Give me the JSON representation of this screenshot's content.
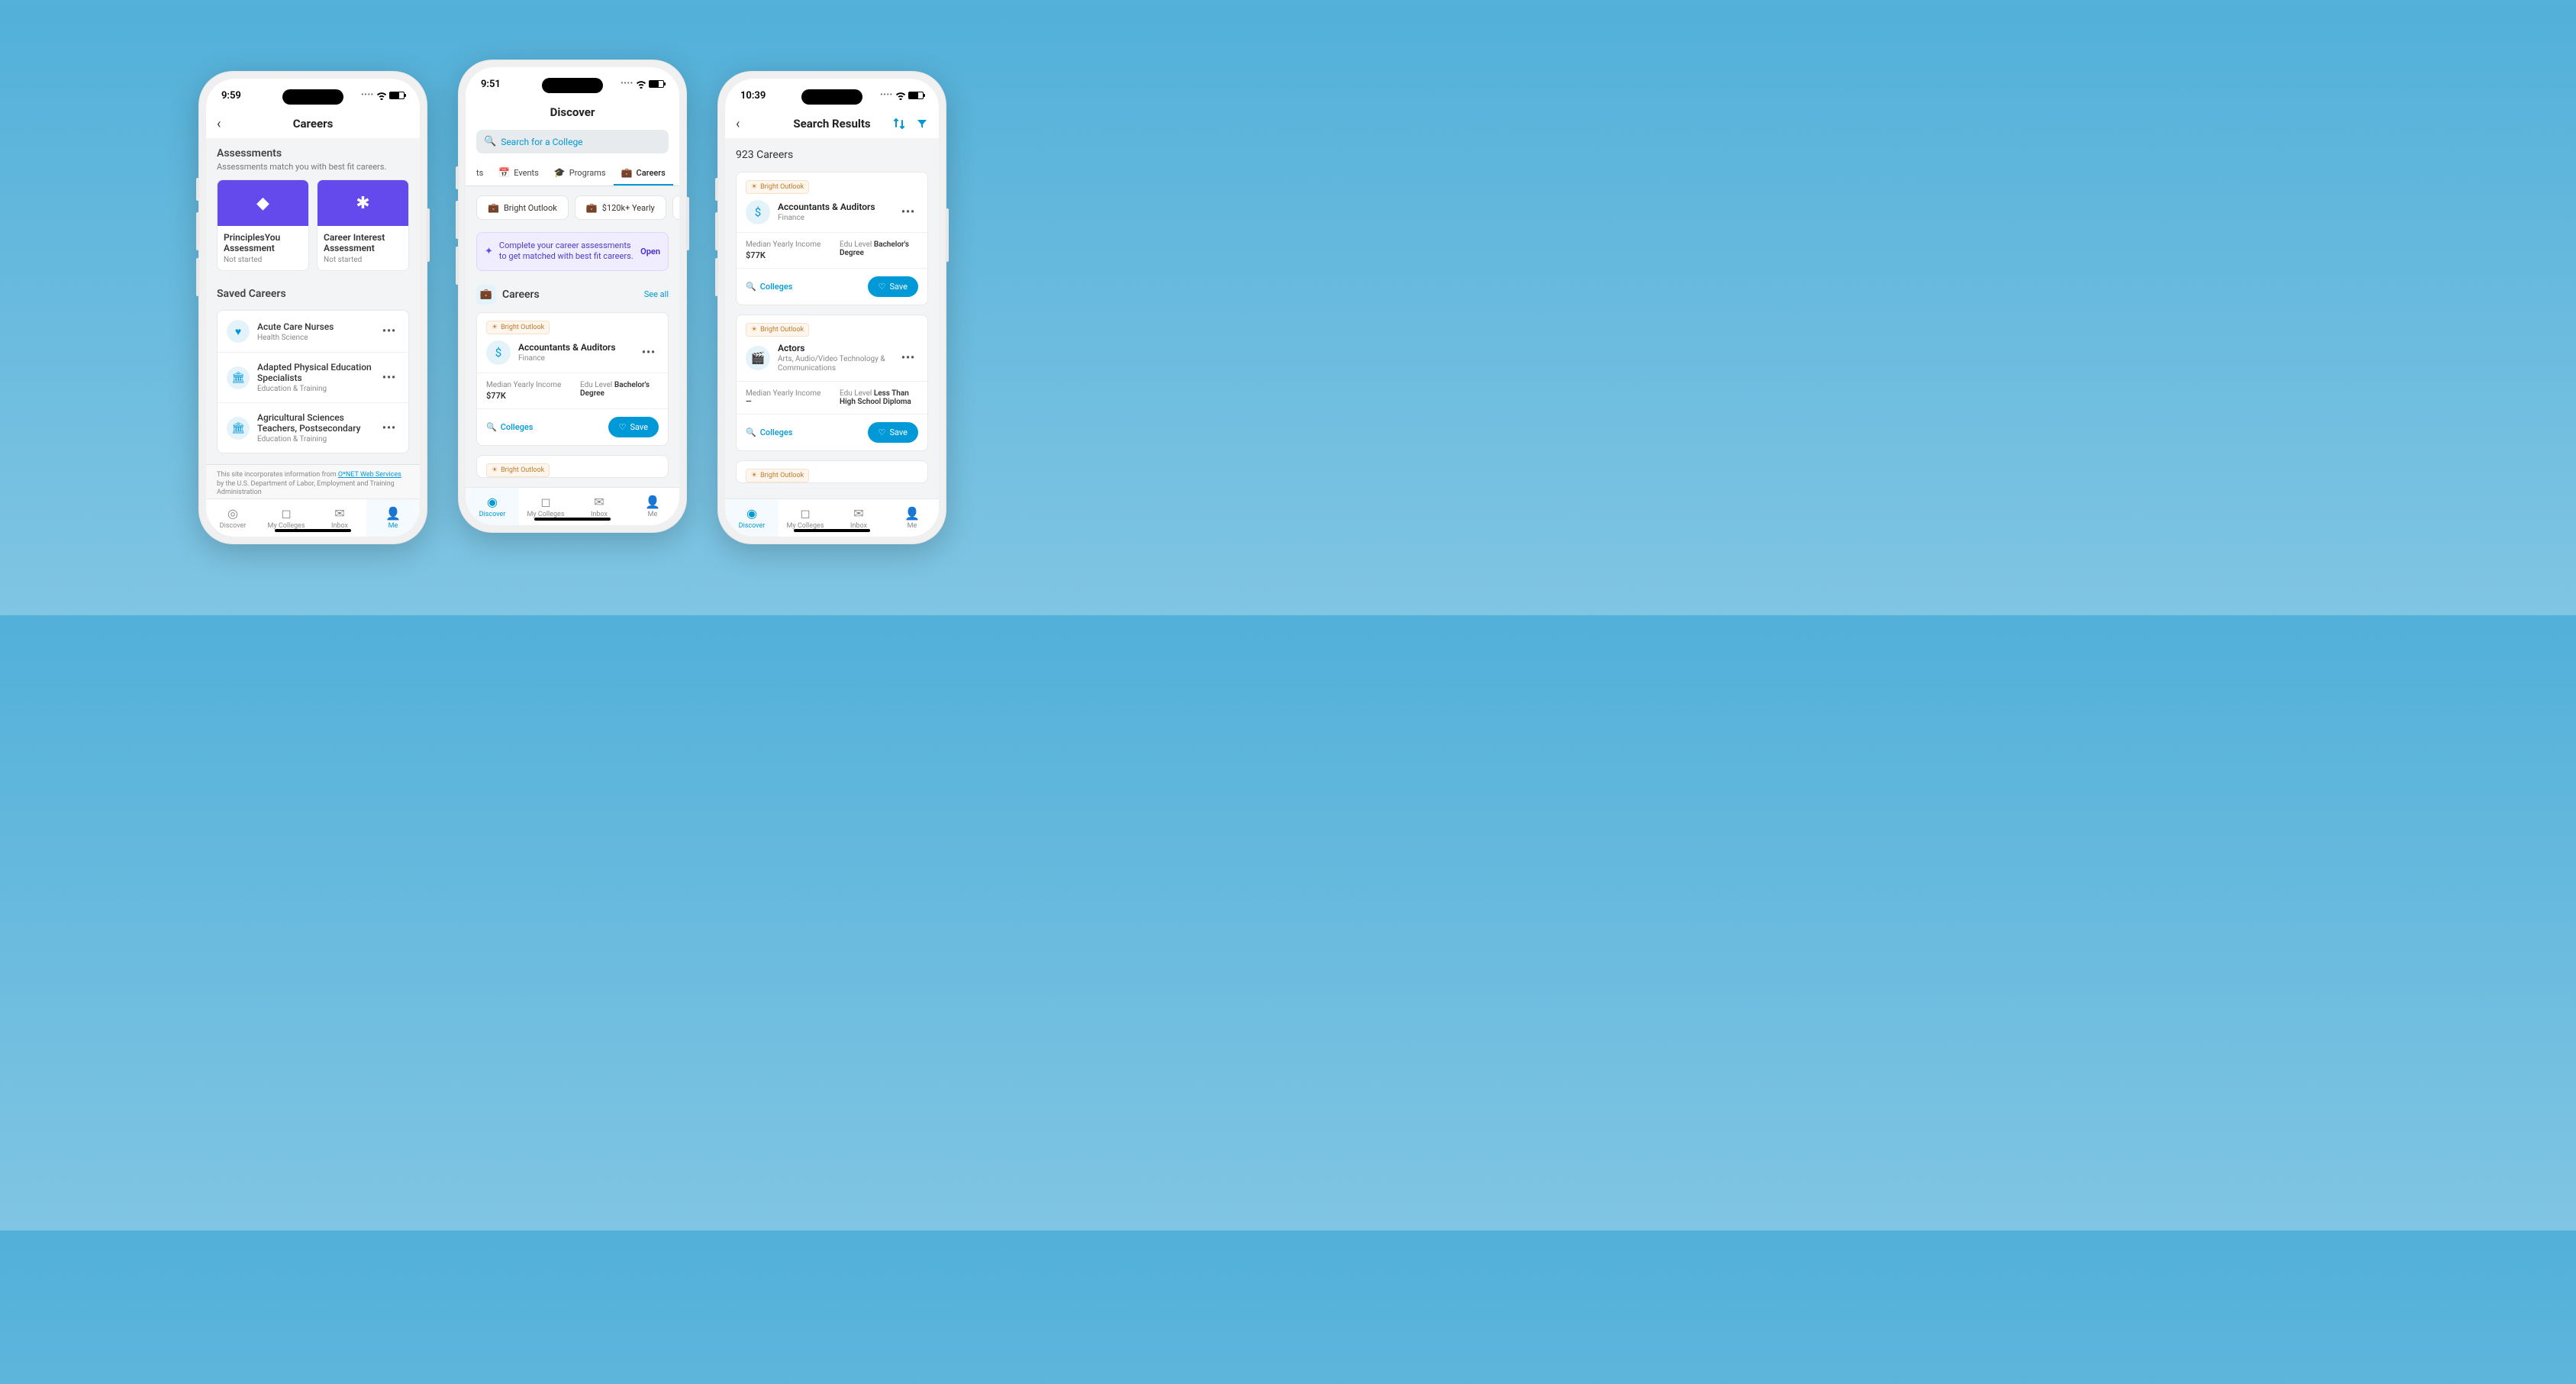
{
  "colors": {
    "accent": "#0099d8",
    "purple": "#6449ed"
  },
  "phone1": {
    "time": "9:59",
    "title": "Careers",
    "assessments": {
      "heading": "Assessments",
      "sub": "Assessments match you with best fit careers.",
      "cards": [
        {
          "title": "PrinciplesYou Assessment",
          "status": "Not started",
          "icon": "◆"
        },
        {
          "title": "Career Interest Assessment",
          "status": "Not started",
          "icon": "✱"
        }
      ]
    },
    "saved": {
      "heading": "Saved Careers",
      "items": [
        {
          "title": "Acute Care Nurses",
          "sub": "Health Science",
          "icon": "heart"
        },
        {
          "title": "Adapted Physical Education Specialists",
          "sub": "Education & Training",
          "icon": "building"
        },
        {
          "title": "Agricultural Sciences Teachers, Postsecondary",
          "sub": "Education & Training",
          "icon": "building"
        }
      ]
    },
    "footer1": "This site incorporates information from ",
    "footerLink": "O*NET Web Services",
    "footer2": " by the U.S. Department of Labor, Employment and Training Administration",
    "tabs": [
      "Discover",
      "My Colleges",
      "Inbox",
      "Me"
    ],
    "active_tab": "Me"
  },
  "phone2": {
    "time": "9:51",
    "title": "Discover",
    "searchPlaceholder": "Search for a College",
    "navTabs": [
      "ts",
      "Events",
      "Programs",
      "Careers"
    ],
    "chips": [
      "Bright Outlook",
      "$120k+ Yearly",
      ""
    ],
    "banner": {
      "text": "Complete your career assessments to get matched with best fit careers.",
      "action": "Open"
    },
    "section": {
      "title": "Careers",
      "seeAll": "See all"
    },
    "career": {
      "badge": "Bright Outlook",
      "title": "Accountants & Auditors",
      "sub": "Finance",
      "stat1_label": "Median Yearly Income",
      "stat1_val": "$77K",
      "stat2_label": "Edu Level ",
      "stat2_val": "Bachelor's Degree",
      "colleges": "Colleges",
      "save": "Save"
    },
    "career2_badge": "Bright Outlook",
    "career2_partial": "",
    "tabs": [
      "Discover",
      "My Colleges",
      "Inbox",
      "Me"
    ],
    "active_tab": "Discover"
  },
  "phone3": {
    "time": "10:39",
    "title": "Search Results",
    "count": "923 Careers",
    "results": [
      {
        "badge": "Bright Outlook",
        "title": "Accountants & Auditors",
        "sub": "Finance",
        "icon": "dollar",
        "stat1_label": "Median Yearly Income",
        "stat1_val": "$77K",
        "stat2_label": "Edu Level ",
        "stat2_val": "Bachelor's Degree",
        "colleges": "Colleges",
        "save": "Save"
      },
      {
        "badge": "Bright Outlook",
        "title": "Actors",
        "sub": "Arts, Audio/Video Technology & Communications",
        "icon": "film",
        "stat1_label": "Median Yearly Income",
        "stat1_val": "—",
        "stat2_label": "Edu Level ",
        "stat2_val": "Less Than High School Diploma",
        "colleges": "Colleges",
        "save": "Save"
      }
    ],
    "partial_badge": "Bright Outlook",
    "tabs": [
      "Discover",
      "My Colleges",
      "Inbox",
      "Me"
    ],
    "active_tab": "Discover"
  }
}
